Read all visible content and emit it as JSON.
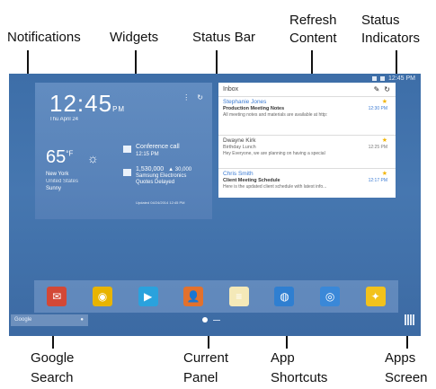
{
  "callouts": {
    "notifications": "Notifications",
    "widgets": "Widgets",
    "status_bar": "Status Bar",
    "refresh_line1": "Refresh",
    "refresh_line2": "Content",
    "status_line1": "Status",
    "status_line2": "Indicators",
    "google_line1": "Google",
    "google_line2": "Search",
    "current_line1": "Current",
    "current_line2": "Panel",
    "app_line1": "App",
    "app_line2": "Shortcuts",
    "apps_line1": "Apps",
    "apps_line2": "Screen"
  },
  "status_bar": {
    "time": "12:45 PM"
  },
  "weather_widget": {
    "time": "12:45",
    "ampm": "PM",
    "date": "Thu April 24",
    "temp": "65",
    "unit": "°F",
    "location": "New York",
    "sublocation": "United States",
    "condition": "Sunny",
    "calendar_title": "Conference call",
    "calendar_time": "12:15 PM",
    "stock_value": "1,530,000",
    "stock_change": "▲ 30,000",
    "stock_name": "Samsung Electronics",
    "stock_note": "Quotes Delayed",
    "updated": "Updated 04/24/2014 12:45 PM"
  },
  "email_widget": {
    "header": "Inbox",
    "messages": [
      {
        "name": "Stephanie Jones",
        "subject": "Production Meeting Notes",
        "preview": "All meeting notes and materials are available at http:",
        "time": "12:30 PM"
      },
      {
        "name": "Dwayne Kirk",
        "subject": "Birthday Lunch",
        "preview": "Hey Everyone, we are planning on having a special",
        "time": "12:25 PM"
      },
      {
        "name": "Chris Smith",
        "subject": "Client Meeting Schedule",
        "preview": "Here is the updated client schedule with latest info...",
        "time": "12:17 PM"
      }
    ]
  },
  "search": {
    "label": "Google"
  },
  "dock": {
    "apps": [
      {
        "icon": "gmail-icon",
        "color": "#d34836",
        "glyph": "✉"
      },
      {
        "icon": "chrome-icon",
        "color": "#e8b400",
        "glyph": "◉"
      },
      {
        "icon": "play-store-icon",
        "color": "#2aa2dd",
        "glyph": "▶"
      },
      {
        "icon": "contacts-icon",
        "color": "#e2712d",
        "glyph": "👤"
      },
      {
        "icon": "memo-icon",
        "color": "#f4e9b8",
        "glyph": "≡"
      },
      {
        "icon": "internet-icon",
        "color": "#2f7fd1",
        "glyph": "◍"
      },
      {
        "icon": "camera-icon",
        "color": "#3a88d8",
        "glyph": "◎"
      },
      {
        "icon": "gallery-icon",
        "color": "#f2c21c",
        "glyph": "✦"
      }
    ]
  }
}
